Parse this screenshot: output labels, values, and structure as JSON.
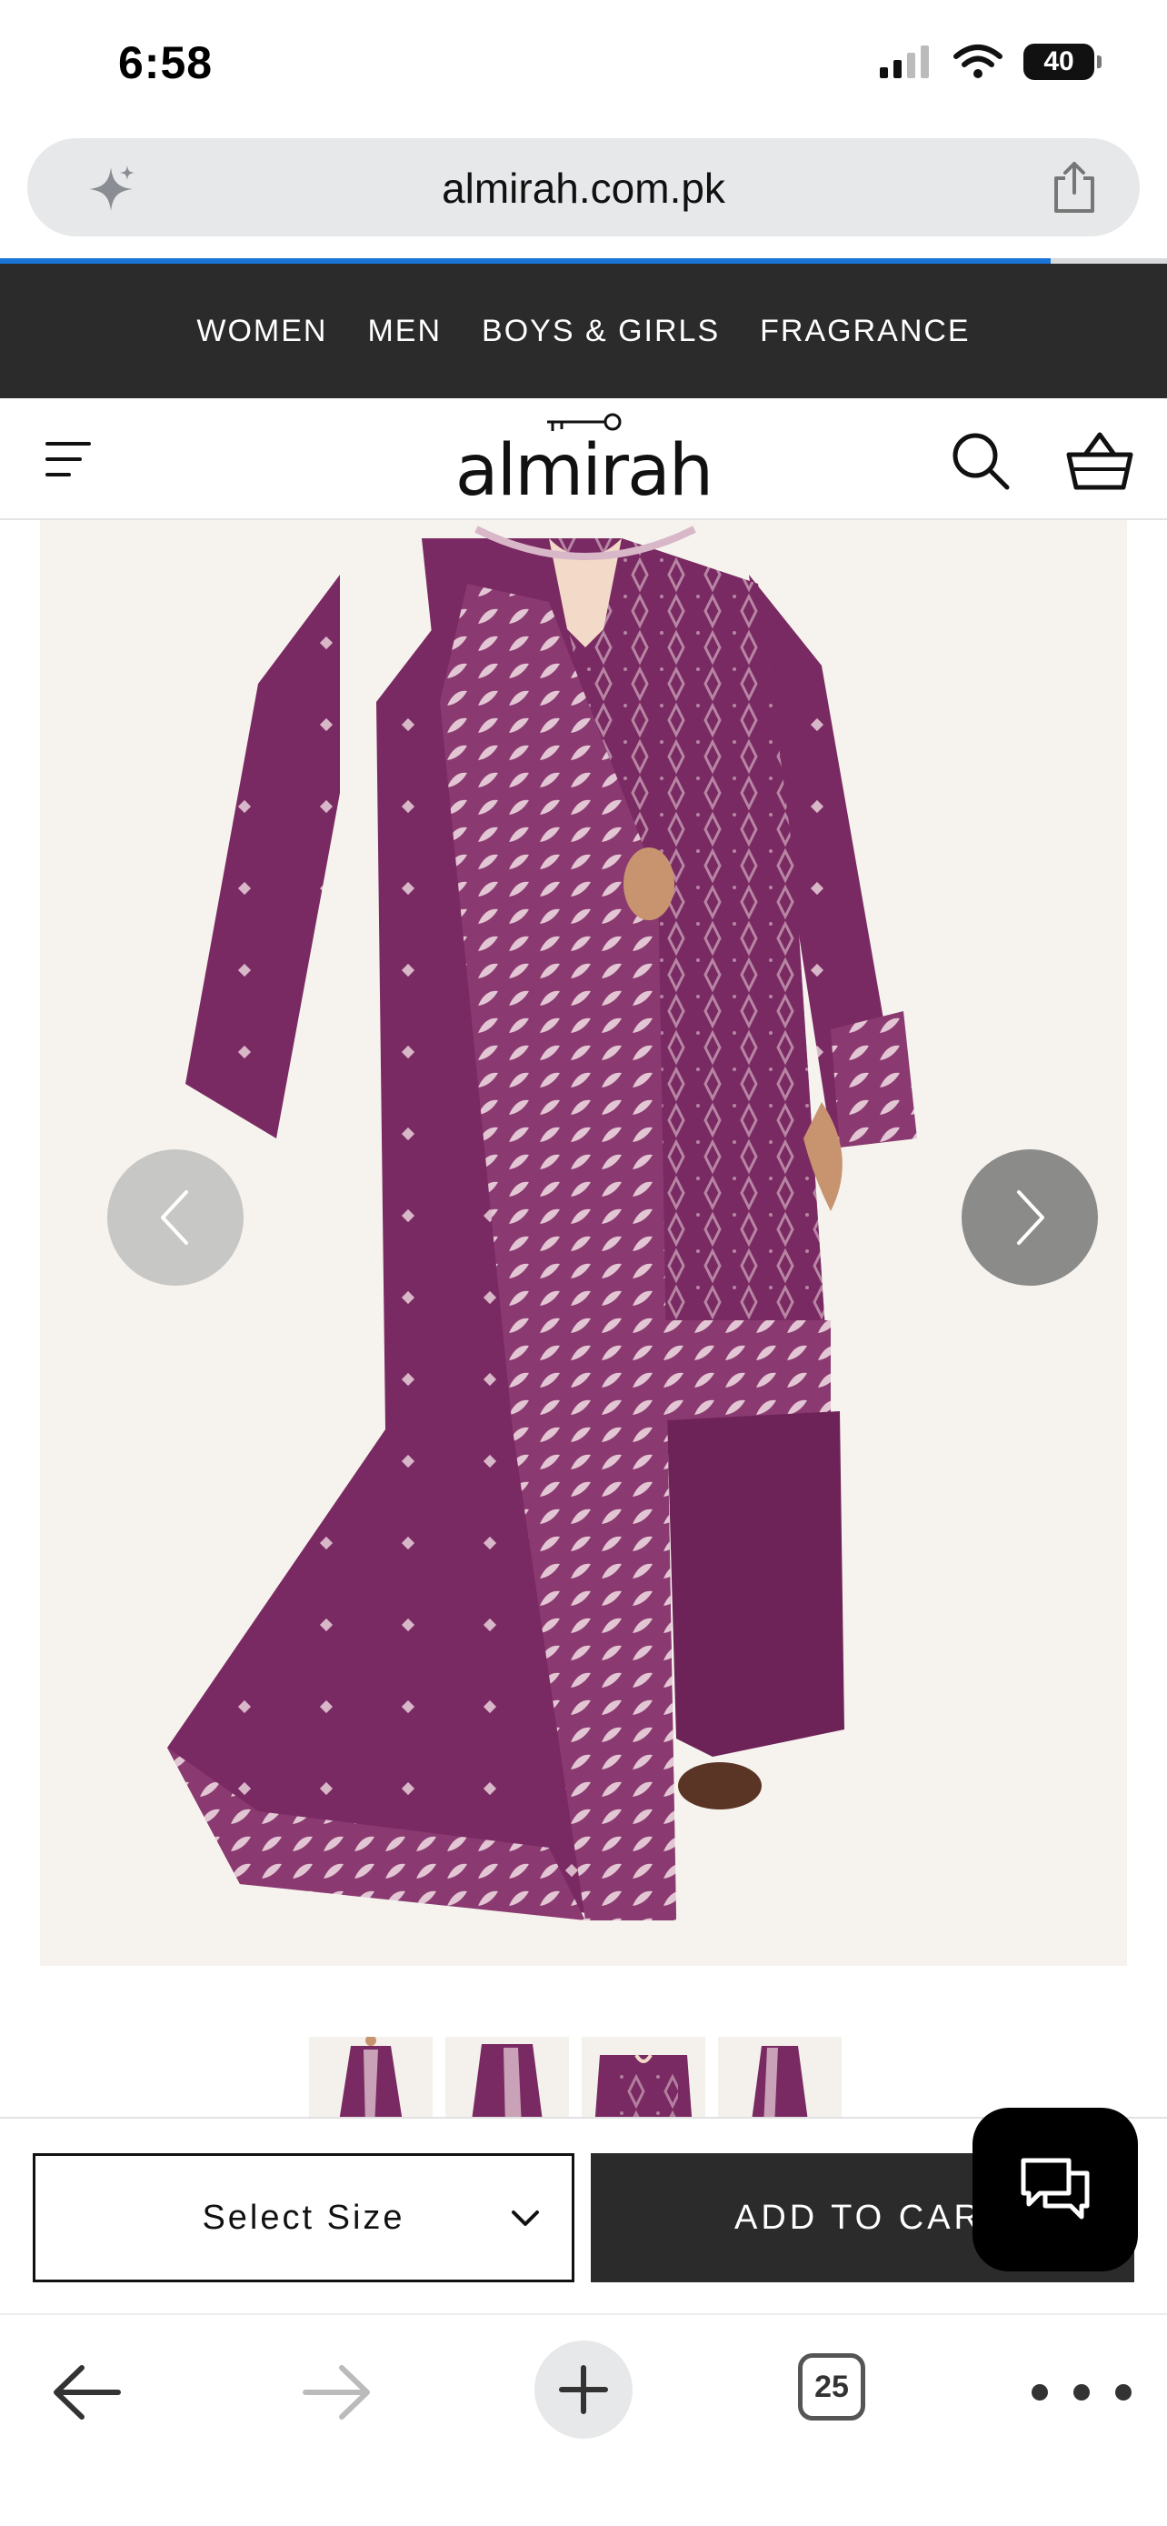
{
  "status_bar": {
    "time": "6:58",
    "battery": "40",
    "icons": [
      "cellular-signal-icon",
      "wifi-icon",
      "battery-icon"
    ]
  },
  "browser": {
    "url": "almirah.com.pk",
    "page_load_progress": 0.9,
    "open_tabs_count": "25",
    "icons": [
      "sparkle-icon",
      "share-icon",
      "back-arrow-icon",
      "forward-arrow-icon",
      "plus-icon",
      "tabs-icon",
      "more-icon"
    ]
  },
  "category_nav": {
    "items": [
      "WOMEN",
      "MEN",
      "BOYS & GIRLS",
      "FRAGRANCE"
    ]
  },
  "header": {
    "logo_text": "almirah",
    "icons": [
      "hamburger-menu-icon",
      "search-icon",
      "shopping-basket-icon"
    ]
  },
  "gallery": {
    "thumbnail_count": 4,
    "active_thumbnail": 0,
    "icons": [
      "chevron-left-icon",
      "chevron-right-icon"
    ]
  },
  "purchase": {
    "size_select_label": "Select Size",
    "add_to_cart_label": "ADD TO CART"
  },
  "chat": {
    "icon": "chat-bubbles-icon"
  },
  "colors": {
    "nav_background": "#2b2b2b",
    "outfit_plum": "#7a2a62",
    "embroidery": "#d8b7c8",
    "progress_blue": "#1a74d6"
  }
}
